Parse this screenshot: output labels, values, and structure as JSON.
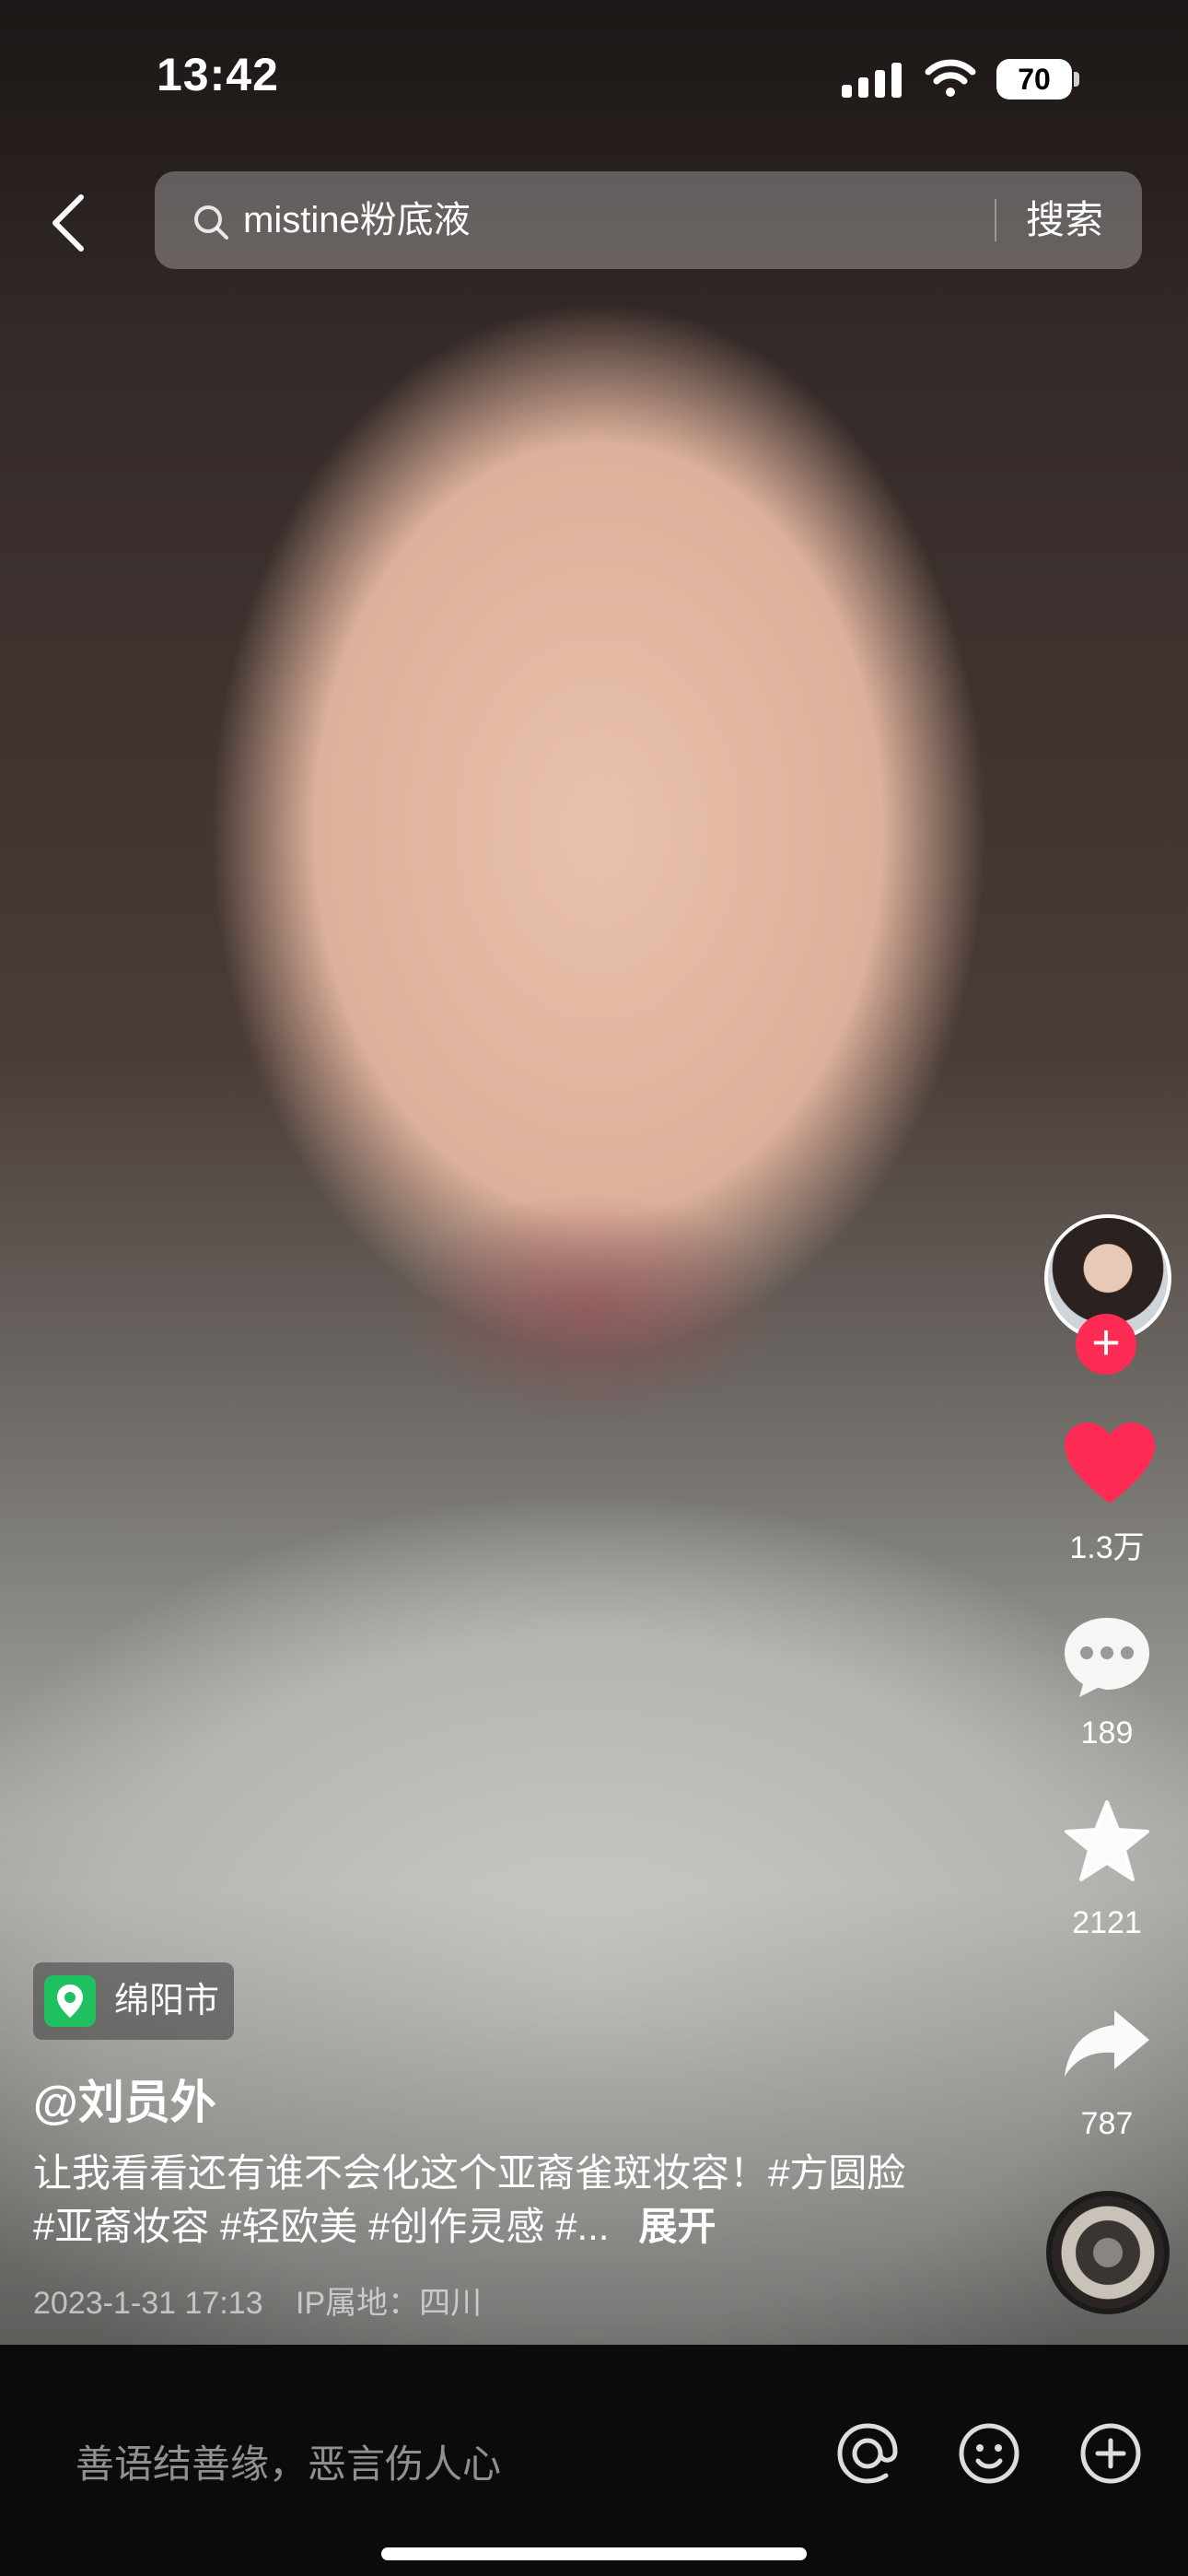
{
  "status": {
    "time": "13:42",
    "battery": "70"
  },
  "search": {
    "query": "mistine粉底液",
    "button_label": "搜索"
  },
  "rail": {
    "likes": "1.3万",
    "comments": "189",
    "favorites": "2121",
    "shares": "787"
  },
  "post": {
    "location": "绵阳市",
    "author": "@刘员外",
    "caption": "让我看看还有谁不会化这个亚裔雀斑妆容！#方圆脸 #亚裔妆容 #轻欧美 #创作灵感 #...",
    "expand_label": "展开",
    "date": "2023-1-31 17:13",
    "ip": "IP属地：四川"
  },
  "comment_bar": {
    "placeholder": "善语结善缘，恶言伤人心"
  },
  "colors": {
    "accent": "#fe2c55",
    "location_green": "#1fc060"
  },
  "icons": [
    "back-icon",
    "search-icon",
    "heart-icon",
    "comment-icon",
    "star-icon",
    "share-icon",
    "at-icon",
    "emoji-icon",
    "plus-icon"
  ]
}
